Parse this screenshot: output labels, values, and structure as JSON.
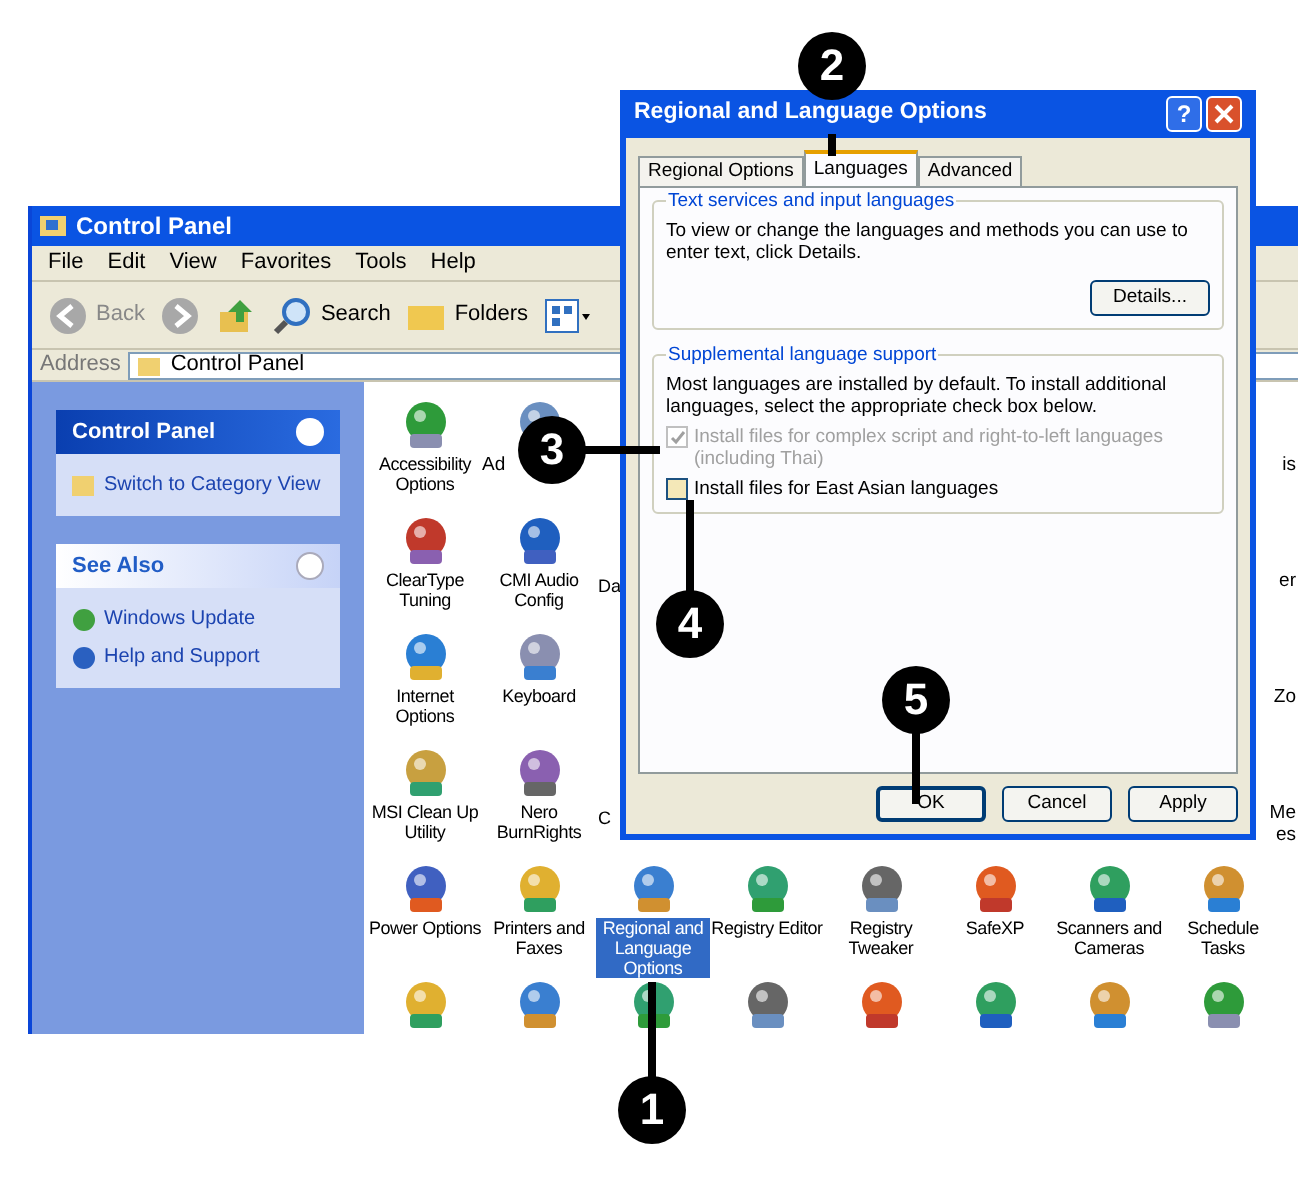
{
  "control_panel": {
    "title": "Control Panel",
    "menu": [
      "File",
      "Edit",
      "View",
      "Favorites",
      "Tools",
      "Help"
    ],
    "toolbar": {
      "back": "Back",
      "search": "Search",
      "folders": "Folders"
    },
    "address": {
      "label": "Address",
      "value": "Control Panel"
    },
    "sidebar": {
      "tasks": {
        "title": "Control Panel",
        "links": [
          "Switch to Category View"
        ]
      },
      "see_also": {
        "title": "See Also",
        "links": [
          "Windows Update",
          "Help and Support"
        ]
      }
    },
    "icon_rows": [
      {
        "items": [
          {
            "label": "Accessibility Options",
            "selected": false
          },
          {
            "label": "Ad",
            "kind": "partial"
          }
        ],
        "right_fragment": [
          "is"
        ]
      },
      {
        "items": [
          {
            "label": "ClearType Tuning",
            "selected": false
          },
          {
            "label": "CMI Audio Config",
            "selected": false
          }
        ],
        "left_fragment": "Da",
        "right_fragment": [
          "er"
        ]
      },
      {
        "items": [
          {
            "label": "Internet Options",
            "selected": false
          },
          {
            "label": "Keyboard",
            "selected": false
          }
        ],
        "right_fragment": [
          "Zo"
        ]
      },
      {
        "items": [
          {
            "label": "MSI Clean Up Utility",
            "selected": false
          },
          {
            "label": "Nero BurnRights",
            "selected": false
          }
        ],
        "left_fragment": "C",
        "right_fragment": [
          "Me",
          "es"
        ]
      },
      {
        "items": [
          {
            "label": "Power Options",
            "selected": false
          },
          {
            "label": "Printers and Faxes",
            "selected": false
          },
          {
            "label": "Regional and Language Options",
            "selected": true
          },
          {
            "label": "Registry Editor",
            "selected": false
          },
          {
            "label": "Registry Tweaker",
            "selected": false
          },
          {
            "label": "SafeXP",
            "selected": false
          },
          {
            "label": "Scanners and Cameras",
            "selected": false
          },
          {
            "label": "Schedule Tasks",
            "selected": false
          }
        ]
      }
    ]
  },
  "dialog": {
    "title": "Regional and Language Options",
    "help_button": "?",
    "tabs": [
      {
        "label": "Regional Options",
        "selected": false
      },
      {
        "label": "Languages",
        "selected": true
      },
      {
        "label": "Advanced",
        "selected": false
      }
    ],
    "groups": [
      {
        "title": "Text services and input languages",
        "text": "To view or change the languages and methods you can use to enter text, click Details.",
        "button": "Details..."
      },
      {
        "title": "Supplemental language support",
        "text": "Most languages are installed by default. To install additional languages, select the appropriate check box below.",
        "checkboxes": [
          {
            "label": "Install files for complex script and right-to-left languages (including Thai)",
            "checked": true,
            "disabled": true
          },
          {
            "label": "Install files for East Asian languages",
            "checked": false,
            "disabled": false
          }
        ]
      }
    ],
    "buttons": [
      "OK",
      "Cancel",
      "Apply"
    ]
  },
  "callouts": [
    {
      "number": "1"
    },
    {
      "number": "2"
    },
    {
      "number": "3"
    },
    {
      "number": "4"
    },
    {
      "number": "5"
    }
  ]
}
